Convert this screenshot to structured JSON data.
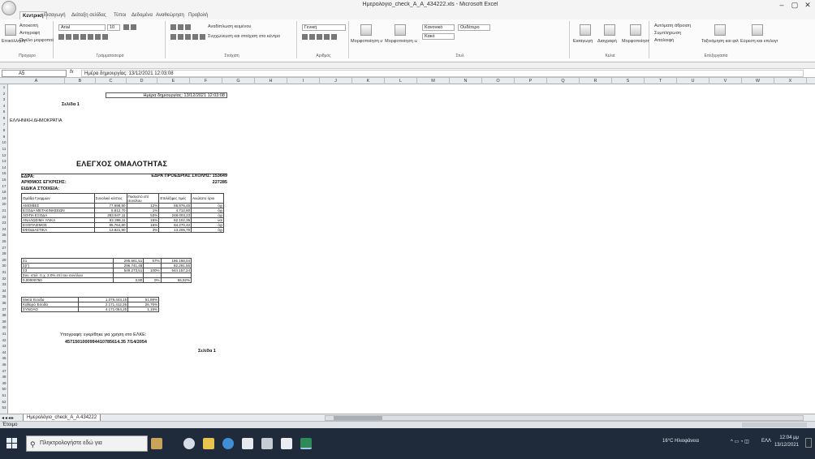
{
  "window": {
    "title": "Ημερολόγιο_check_A_A_434222.xls - Microsoft Excel",
    "minimize": "–",
    "maximize": "▢",
    "close": "✕"
  },
  "ribbon": {
    "tabs": [
      "Κεντρική",
      "Εισαγωγή",
      "Διάταξη σελίδας",
      "Τύποι",
      "Δεδομένα",
      "Αναθεώρηση",
      "Προβολή"
    ],
    "clipboard": {
      "paste": "Επικόλληση",
      "cut": "Αποκοπή",
      "copy": "Αντιγραφή",
      "painter": "Πινέλο μορφοποίησης",
      "label": "Πρόχειρο"
    },
    "font": {
      "name": "Arial",
      "size": "10",
      "label": "Γραμματοσειρά"
    },
    "alignment": {
      "wrap": "Αναδίπλωση κειμένου",
      "merge": "Συγχώνευση και στοίχιση στο κέντρο",
      "label": "Στοίχιση"
    },
    "number": {
      "format": "Γενική",
      "label": "Αριθμός"
    },
    "styles": {
      "conditional": "Μορφοποίηση υπό όρους",
      "table": "Μορφοποίηση ως πίνακα",
      "normal": "Κανονικό",
      "bad": "Ουδέτερο",
      "good": "Κακό",
      "label": "Στυλ"
    },
    "cells": {
      "insert": "Εισαγωγή",
      "delete": "Διαγραφή",
      "format": "Μορφοποίηση",
      "label": "Κελιά"
    },
    "editing": {
      "autosum": "Αυτόματη άθροιση",
      "fill": "Συμπλήρωση",
      "clear": "Απαλοιφή",
      "sort": "Ταξινόμηση και φιλτράρισμα",
      "find": "Εύρεση και επιλογή",
      "label": "Επεξεργασία"
    }
  },
  "formula_bar": {
    "cell_ref": "A5",
    "fx": "fx",
    "value": "Ημέρα δημιουργίας: 13/12/2021 12:03:08"
  },
  "columns": [
    "A",
    "B",
    "C",
    "D",
    "E",
    "F",
    "G",
    "H",
    "I",
    "J",
    "K",
    "L",
    "M",
    "N",
    "O",
    "P",
    "Q",
    "R",
    "S",
    "T",
    "U",
    "V",
    "W",
    "X",
    "Y",
    "Z",
    "AA"
  ],
  "rows": [
    "1",
    "2",
    "3",
    "4",
    "5",
    "6",
    "7",
    "8",
    "9",
    "10",
    "11",
    "12",
    "13",
    "14",
    "15",
    "16",
    "17",
    "18",
    "19",
    "20",
    "21",
    "22",
    "23",
    "24",
    "25",
    "26",
    "27",
    "28",
    "29",
    "30",
    "31",
    "32",
    "33",
    "34",
    "35",
    "36",
    "37",
    "38",
    "39",
    "40",
    "41",
    "42",
    "43",
    "44",
    "45",
    "46",
    "47",
    "48",
    "49",
    "50",
    "51",
    "52",
    "53"
  ],
  "sheet": {
    "created": "Ημέρα δημιουργίας: 13/12/2021 12:03:08",
    "page_top": "Σελίδα 1",
    "republic": "ΕΛΛΗΝΙΚΗ ΔΗΜΟΚΡΑΤΙΑ",
    "heading": "ΕΛΕΓΧΟΣ ΟΜΑΛΟΤΗΤΑΣ",
    "fields": [
      {
        "label": "ΕΔΡΑ:",
        "value": "ΕΔΡΑ ΠΡΟΕΔΡΙΑΣ ΣΧΟΛΗΣ: 153649"
      },
      {
        "label": "ΑΡΙΘΜΟΣ ΕΓΚΡΙΣΗΣ:",
        "value": "227285"
      },
      {
        "label": "ΕΙΔΙΚΑ ΣΤΟΙΧΕΙΑ:",
        "value": ""
      }
    ],
    "table_head": [
      "Ομάδα Γραμμών",
      "Συνολικό κόστος",
      "Ποσοστό επί συνόλου",
      "Επιλέξιμες τιμές",
      "Ανώτατο όριο"
    ],
    "table_rows": [
      [
        "ΑΜΟΙΒΕΣ",
        "77.698,90",
        "12%",
        "65.876,45",
        "όχι"
      ],
      [
        "ΕΞΟΔΑ ΜΕΤΑΚΙΝΗΣΕΩΝ",
        "5.812,70",
        "1%",
        "4.712,80",
        "όχι"
      ],
      [
        "ΛΟΙΠΑ ΕΞΟΔΑ",
        "283.947,11",
        "53%",
        "248.003,23",
        "όχι"
      ],
      [
        "ΑΝΑΛΩΣΙΜΑ ΥΛΙΚΑ",
        "82.398,11",
        "15%",
        "62.102,35",
        "ναι"
      ],
      [
        "ΕΞΟΠΛΙΣΜΟΣ",
        "85.764,80",
        "16%",
        "84.270,42",
        "όχι"
      ],
      [
        "ΕΦΟΔΙΑΣΤΙΚΑ",
        "13.921,90",
        "3%",
        "13.205,78",
        "όχι"
      ]
    ],
    "totals_rows": [
      [
        "Σ1",
        "295.661,51",
        "57%",
        "186.168,04"
      ],
      [
        "Σ(Γ)",
        "296.741,48",
        "",
        "82.291,55"
      ],
      [
        "Σ3",
        "549.273,51",
        "100%",
        "544.157,24"
      ],
      [
        "Συν. επιλ. π.χ. 2.0% επί του συνόλου",
        "",
        "",
        ""
      ],
      [
        "0,00000750",
        "3,80",
        "0%",
        "56,92%"
      ]
    ],
    "summary_rows": [
      [
        "Μικτά Έσοδα",
        "1.075.443,15",
        "51,99%"
      ],
      [
        "Καθαρά Έσοδα",
        "2.171.412,26",
        "26,76%"
      ],
      [
        "ΣΥΝΟΛΟ",
        "4.171.054,25",
        "1,19%"
      ]
    ],
    "footnote1": "Υπογραφή: εγκρίθηκε για χρήση στο ΕΛΚΕ:",
    "footnote2": "4571501000994410785614.35 7/14/2054",
    "page_bottom": "Σελίδα 1"
  },
  "sheet_tab": "Ημερολόγιο_check_A_A 434222",
  "status": "Έτοιμο",
  "taskbar": {
    "search": "Πληκτρολογήστε εδώ για",
    "weather": "16°C Ηλιοφάνεια",
    "lang": "ΕΛΛ",
    "time": "12:04 μμ",
    "date": "13/12/2021"
  }
}
